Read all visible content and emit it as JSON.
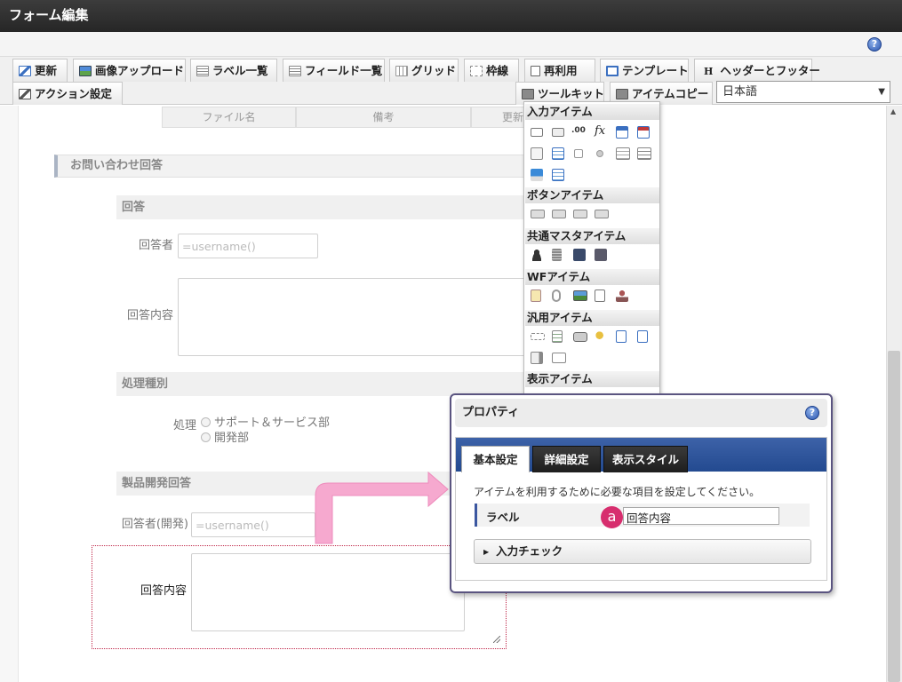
{
  "window": {
    "title": "フォーム編集"
  },
  "toolbar": {
    "tabs_row1": [
      {
        "label": "更新",
        "icon": "update-icon"
      },
      {
        "label": "画像アップロード",
        "icon": "image-upload-icon"
      },
      {
        "label": "ラベル一覧",
        "icon": "label-list-icon"
      },
      {
        "label": "フィールド一覧",
        "icon": "field-list-icon"
      },
      {
        "label": "グリッド",
        "icon": "grid-icon"
      },
      {
        "label": "枠線",
        "icon": "border-icon"
      },
      {
        "label": "再利用",
        "icon": "reuse-icon"
      },
      {
        "label": "テンプレート",
        "icon": "template-icon"
      },
      {
        "label": "ヘッダーとフッター",
        "icon": "header-footer-icon"
      }
    ],
    "tabs_row2": [
      {
        "label": "アクション設定",
        "icon": "action-icon"
      },
      {
        "label": "ツールキット",
        "icon": "toolkit-icon"
      },
      {
        "label": "アイテムコピー",
        "icon": "item-copy-icon"
      }
    ],
    "header_footer_glyph": "H",
    "language": "日本語"
  },
  "form": {
    "table_headers": [
      "ファイル名",
      "備考",
      "更新"
    ],
    "section_title": "お問い合わせ回答",
    "group_answer": "回答",
    "answerer_label": "回答者",
    "answerer_value": "=username()",
    "answer_content_label": "回答内容",
    "group_type": "処理種別",
    "type_label": "処理",
    "type_options": [
      "サポート＆サービス部",
      "開発部"
    ],
    "group_dev": "製品開発回答",
    "dev_answerer_label": "回答者(開発)",
    "dev_answerer_value": "=username()",
    "dev_content_label": "回答内容"
  },
  "palette": {
    "headers": [
      "入力アイテム",
      "ボタンアイテム",
      "共通マスタアイテム",
      "WFアイテム",
      "汎用アイテム",
      "表示アイテム"
    ],
    "numeric_glyph": ".00",
    "fx_glyph": "fx"
  },
  "properties": {
    "title": "プロパティ",
    "tabs": [
      "基本設定",
      "詳細設定",
      "表示スタイル"
    ],
    "description": "アイテムを利用するために必要な項目を設定してください。",
    "label_field_label": "ラベル",
    "label_field_value": "回答内容",
    "badge": "a",
    "accordion": "入力チェック"
  },
  "colors": {
    "accent": "#234a90",
    "highlight": "#d72e6e",
    "arrow": "#f6a9cf"
  }
}
